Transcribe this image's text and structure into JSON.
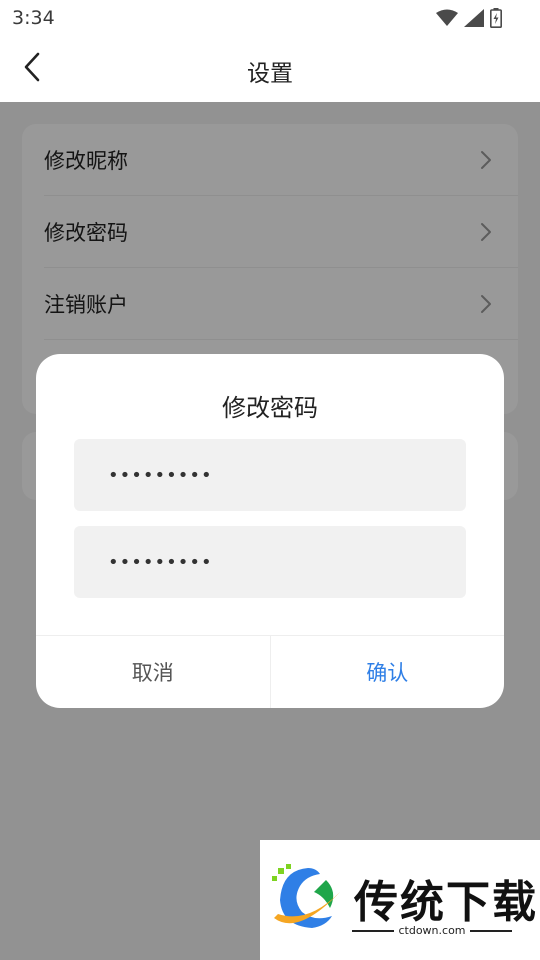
{
  "status_bar": {
    "time": "3:34",
    "icons": [
      "wifi-icon",
      "signal-icon",
      "battery-icon"
    ]
  },
  "header": {
    "title": "设置",
    "back_icon": "chevron-left-icon"
  },
  "settings": {
    "items": [
      {
        "label": "修改昵称",
        "icon": "chevron-right-icon"
      },
      {
        "label": "修改密码",
        "icon": "chevron-right-icon"
      },
      {
        "label": "注销账户",
        "icon": "chevron-right-icon"
      }
    ]
  },
  "dialog": {
    "title": "修改密码",
    "password_1": "•••••••••",
    "password_2": "•••••••••",
    "cancel_label": "取消",
    "confirm_label": "确认"
  },
  "watermark": {
    "brand": "传统下载",
    "url": "ctdown.com"
  },
  "colors": {
    "accent": "#2f7fe6",
    "overlay": "rgba(0,0,0,0.4)",
    "input_bg": "#f1f1f1"
  }
}
